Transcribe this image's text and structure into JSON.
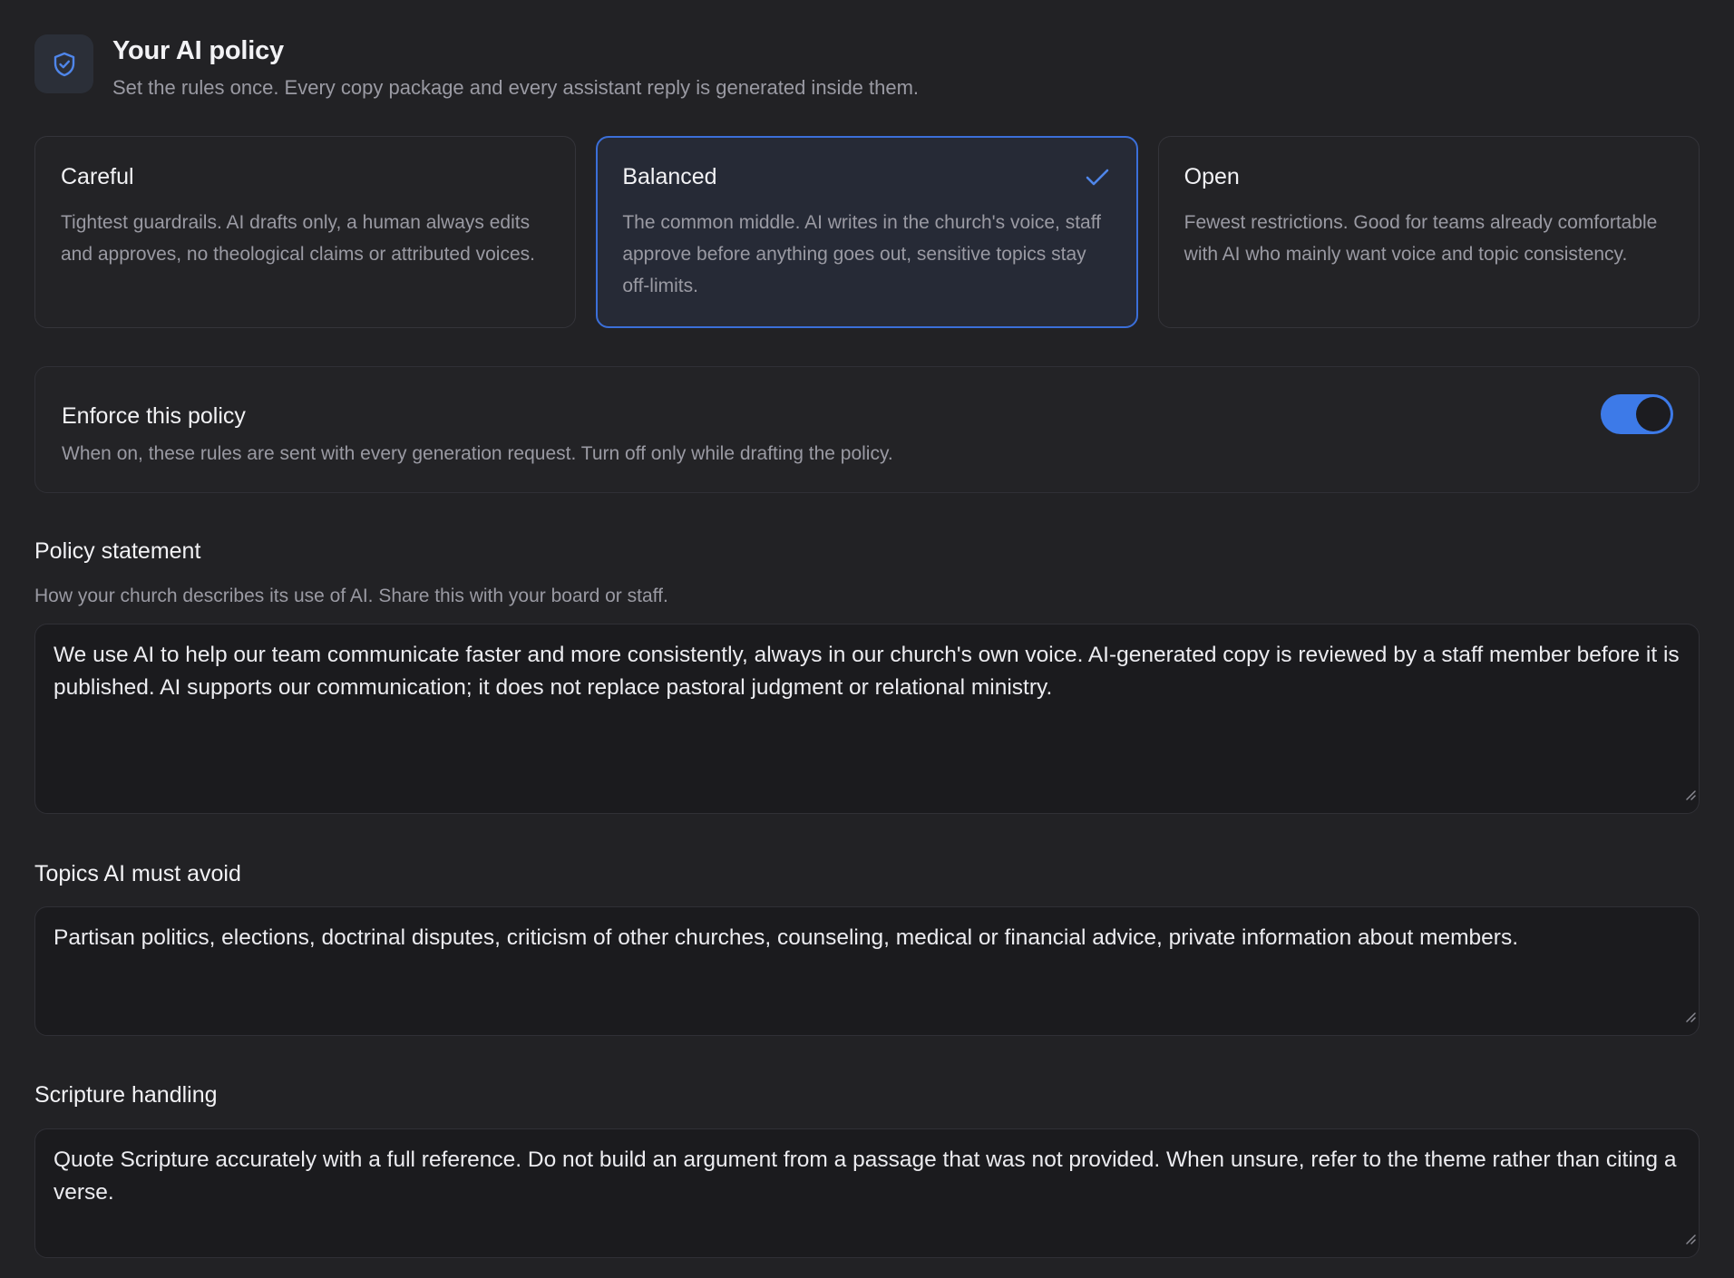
{
  "header": {
    "icon": "shield-check-icon",
    "title": "Your AI policy",
    "subtitle": "Set the rules once. Every copy package and every assistant reply is generated inside them."
  },
  "presets": [
    {
      "name": "Careful",
      "description": "Tightest guardrails. AI drafts only, a human always edits and approves, no theological claims or attributed voices.",
      "selected": false
    },
    {
      "name": "Balanced",
      "description": "The common middle. AI writes in the church's voice, staff approve before anything goes out, sensitive topics stay off-limits.",
      "selected": true
    },
    {
      "name": "Open",
      "description": "Fewest restrictions. Good for teams already comfortable with AI who mainly want voice and topic consistency.",
      "selected": false
    }
  ],
  "enforce": {
    "title": "Enforce this policy",
    "description": "When on, these rules are sent with every generation request. Turn off only while drafting the policy.",
    "enabled": true
  },
  "policy_statement": {
    "label": "Policy statement",
    "help": "How your church describes its use of AI. Share this with your board or staff.",
    "value": "We use AI to help our team communicate faster and more consistently, always in our church's own voice. AI-generated copy is reviewed by a staff member before it is published. AI supports our communication; it does not replace pastoral judgment or relational ministry."
  },
  "topics_to_avoid": {
    "label": "Topics AI must avoid",
    "value": "Partisan politics, elections, doctrinal disputes, criticism of other churches, counseling, medical or financial advice, private information about members."
  },
  "scripture_handling": {
    "label": "Scripture handling",
    "value": "Quote Scripture accurately with a full reference. Do not build an argument from a passage that was not provided. When unsure, refer to the theme rather than citing a verse."
  },
  "colors": {
    "background": "#222225",
    "accent": "#3d7ae8",
    "selected_border": "#3b6fd9",
    "muted_text": "#9a9aa3"
  }
}
